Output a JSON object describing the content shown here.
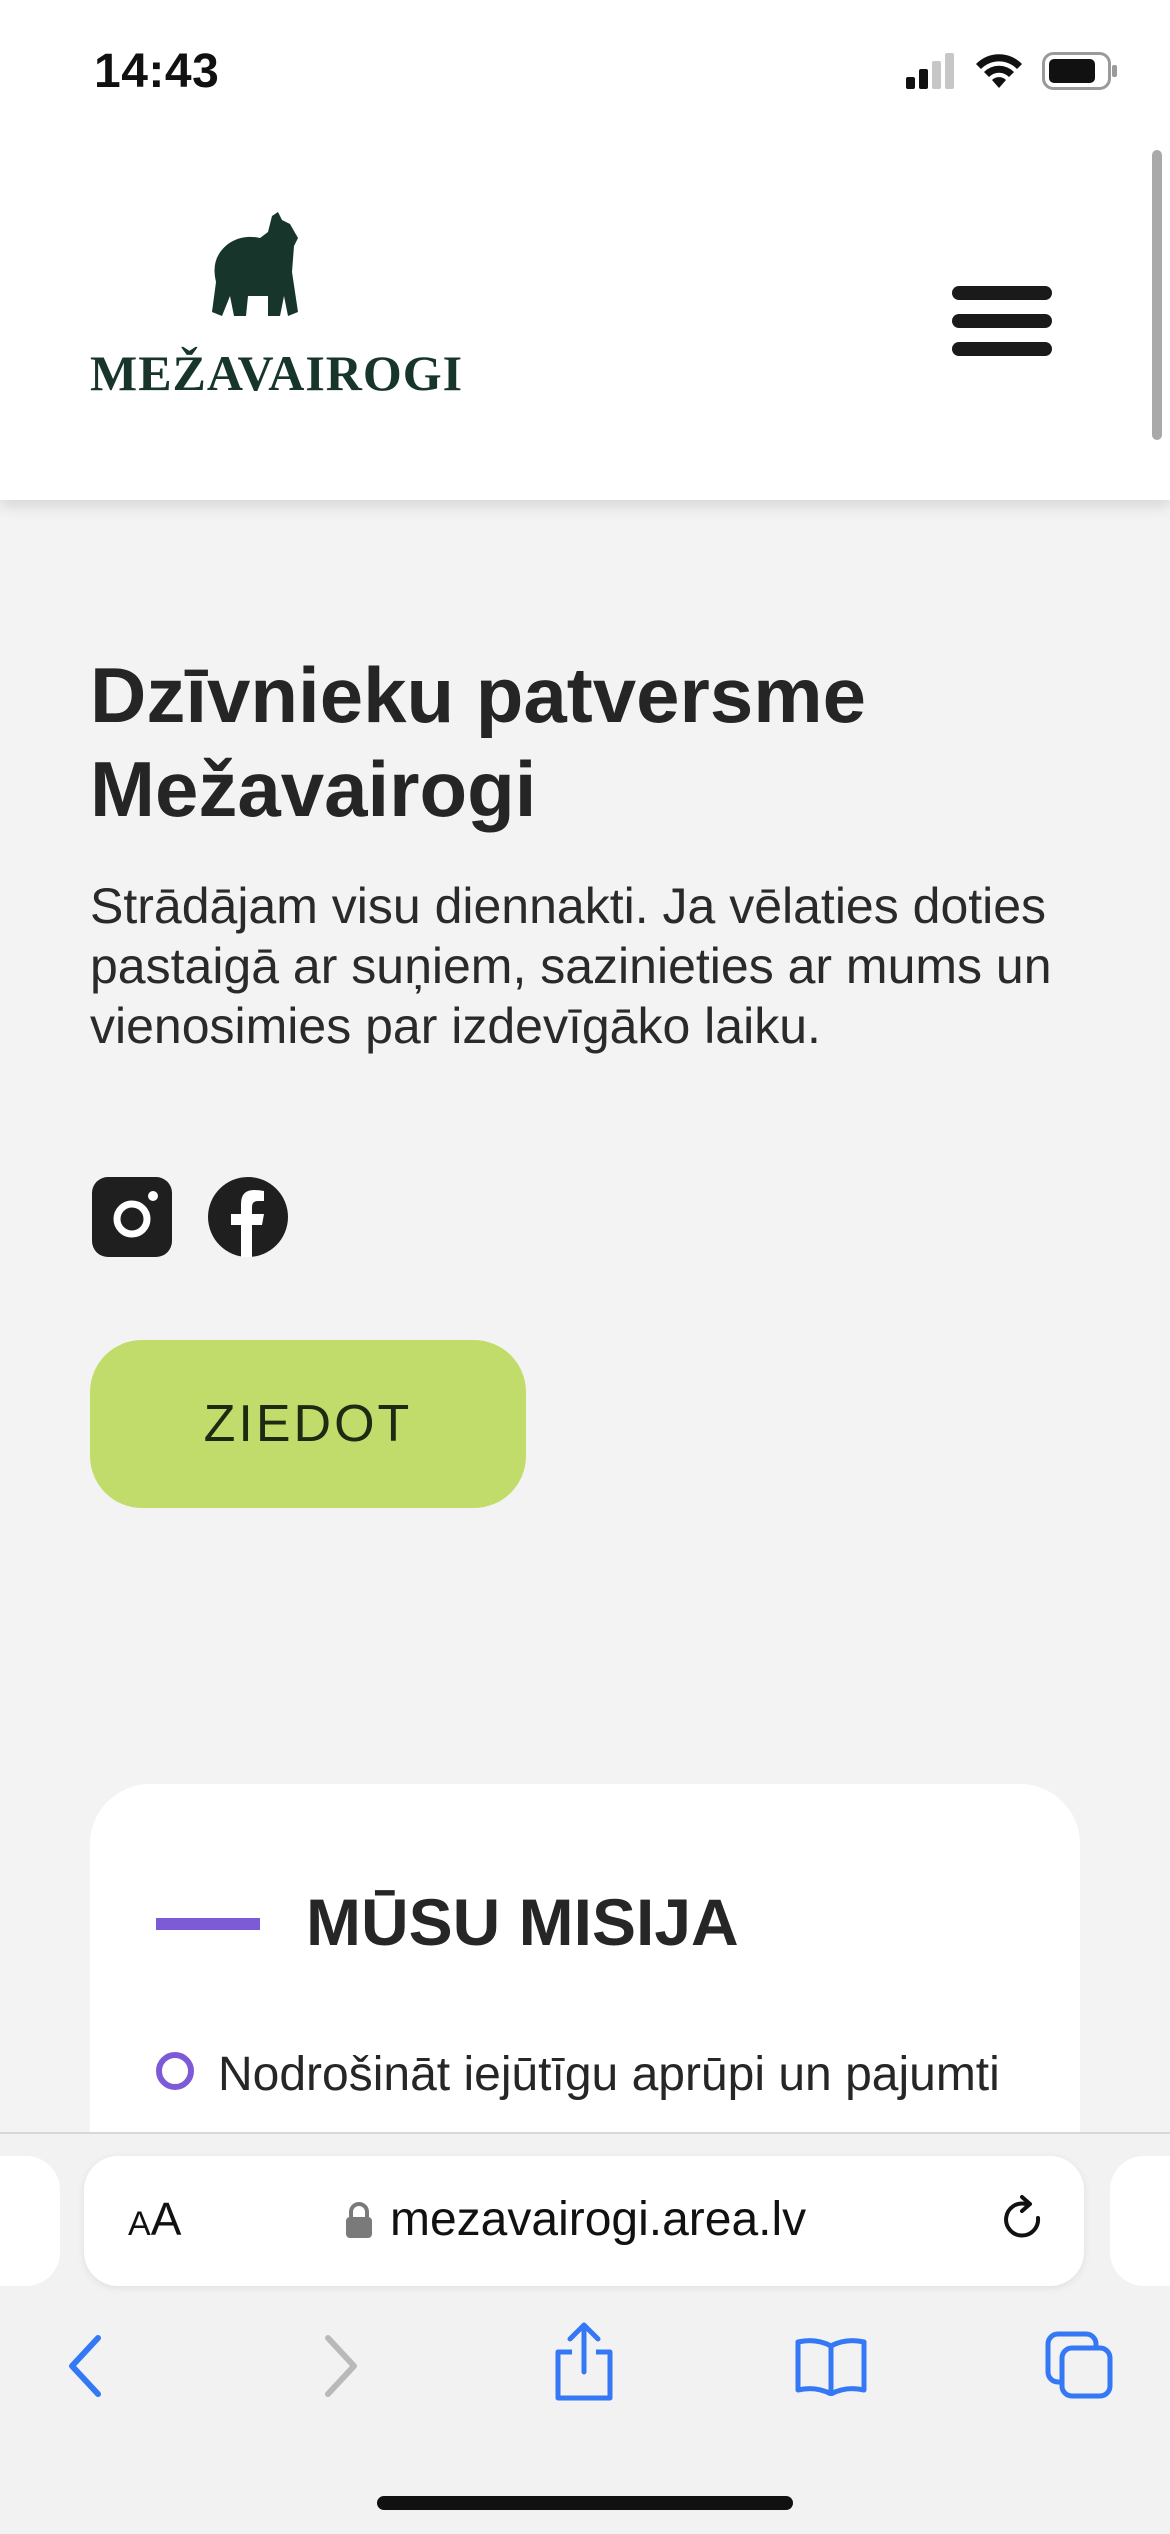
{
  "status_bar": {
    "time": "14:43",
    "icons": [
      "cellular-signal-icon",
      "wifi-icon",
      "battery-icon"
    ]
  },
  "header": {
    "logo_text": "MEŽAVAIROGI",
    "logo_icon": "bear-icon",
    "menu_icon": "hamburger-menu-icon"
  },
  "hero": {
    "title": "Dzīvnieku patversme Mežavairogi",
    "description": "Strādājam visu diennakti. Ja vēlaties doties pastaigā ar suņiem, sazinieties ar mums un vienosimies par izdevīgāko laiku.",
    "socials": [
      "instagram-icon",
      "facebook-icon"
    ],
    "donate_label": "ZIEDOT"
  },
  "mission": {
    "title": "MŪSU MISIJA",
    "items": [
      "Nodrošināt iejūtīgu aprūpi un pajumti"
    ]
  },
  "browser": {
    "text_size_label_small": "A",
    "text_size_label_large": "A",
    "url": "mezavairogi.area.lv",
    "toolbar": [
      "back-icon",
      "forward-icon",
      "share-icon",
      "bookmarks-icon",
      "tabs-icon"
    ]
  },
  "colors": {
    "brand_dark_green": "#17352a",
    "donate_green": "#c1dc6b",
    "accent_purple": "#7e5bd6",
    "ios_blue": "#3478f6",
    "page_bg": "#f3f3f3"
  }
}
